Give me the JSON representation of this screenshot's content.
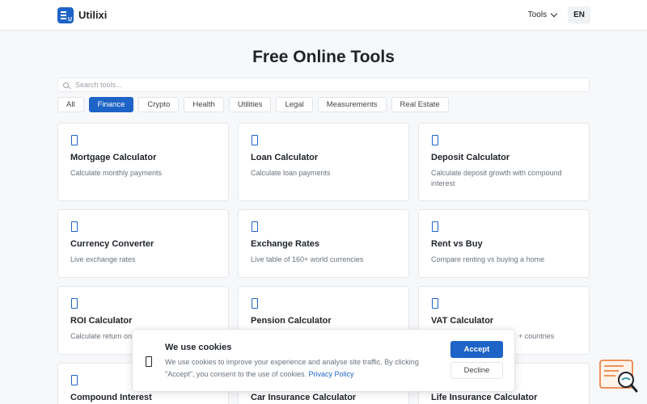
{
  "header": {
    "brand": "Utilixi",
    "tools_label": "Tools",
    "lang_label": "EN"
  },
  "page_title": "Free Online Tools",
  "search": {
    "placeholder": "Search tools..."
  },
  "filters": [
    "All",
    "Finance",
    "Crypto",
    "Health",
    "Utilities",
    "Legal",
    "Measurements",
    "Real Estate"
  ],
  "active_filter": "Finance",
  "cards": [
    {
      "title": "Mortgage Calculator",
      "desc": "Calculate monthly payments"
    },
    {
      "title": "Loan Calculator",
      "desc": "Calculate loan payments"
    },
    {
      "title": "Deposit Calculator",
      "desc": "Calculate deposit growth with compound interest"
    },
    {
      "title": "Currency Converter",
      "desc": "Live exchange rates"
    },
    {
      "title": "Exchange Rates",
      "desc": "Live table of 160+ world currencies"
    },
    {
      "title": "Rent vs Buy",
      "desc": "Compare renting vs buying a home"
    },
    {
      "title": "ROI Calculator",
      "desc": "Calculate return on"
    },
    {
      "title": "Pension Calculator",
      "desc": ""
    },
    {
      "title": "VAT Calculator",
      "desc": "+ countries"
    },
    {
      "title": "Compound Interest",
      "desc": ""
    },
    {
      "title": "Car Insurance Calculator",
      "desc": ""
    },
    {
      "title": "Life Insurance Calculator",
      "desc": ""
    }
  ],
  "cookie": {
    "title": "We use cookies",
    "text": "We use cookies to improve your experience and analyse site traffic. By clicking \"Accept\", you consent to the use of cookies.",
    "link": "Privacy Policy",
    "accept": "Accept",
    "decline": "Decline"
  },
  "colors": {
    "accent": "#1e63c6",
    "help_widget": "#e8702a"
  },
  "icons": {
    "card": "device-icon",
    "cookie": "cookie-icon",
    "help": "help-search-icon"
  }
}
